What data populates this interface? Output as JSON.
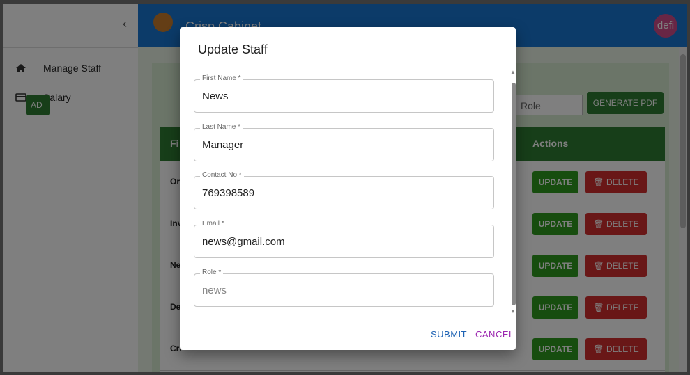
{
  "app": {
    "title": "Crisp Cabinet",
    "avatar_text": "defi"
  },
  "drawer": {
    "collapse_icon": "chevron-left-icon",
    "items": [
      {
        "label": "Manage Staff",
        "icon": "home-icon"
      },
      {
        "label": "Salary",
        "icon": "credit-card-icon"
      }
    ]
  },
  "toolbar": {
    "add_label": "AD",
    "role_placeholder": "Role",
    "generate_pdf_label": "GENERATE PDF"
  },
  "table": {
    "header_first": "Fi",
    "header_actions": "Actions",
    "rows": [
      {
        "first": "Or"
      },
      {
        "first": "Inv"
      },
      {
        "first": "Ne"
      },
      {
        "first": "Del"
      },
      {
        "first": "Cri"
      }
    ],
    "update_label": "UPDATE",
    "delete_label": "DELETE"
  },
  "dialog": {
    "title": "Update Staff",
    "fields": {
      "first_name": {
        "label": "First Name *",
        "value": "News"
      },
      "last_name": {
        "label": "Last Name *",
        "value": "Manager"
      },
      "contact_no": {
        "label": "Contact No *",
        "value": "769398589"
      },
      "email": {
        "label": "Email *",
        "value": "news@gmail.com"
      },
      "role": {
        "label": "Role *",
        "value": "news"
      }
    },
    "submit_label": "SUBMIT",
    "cancel_label": "CANCEL"
  },
  "colors": {
    "appbar": "#1976d2",
    "primary_green": "#2e7d32",
    "update_green": "#2e9a1e",
    "delete_red": "#d32f2f",
    "submit_blue": "#1e63b4",
    "cancel_purple": "#9c27b0"
  }
}
